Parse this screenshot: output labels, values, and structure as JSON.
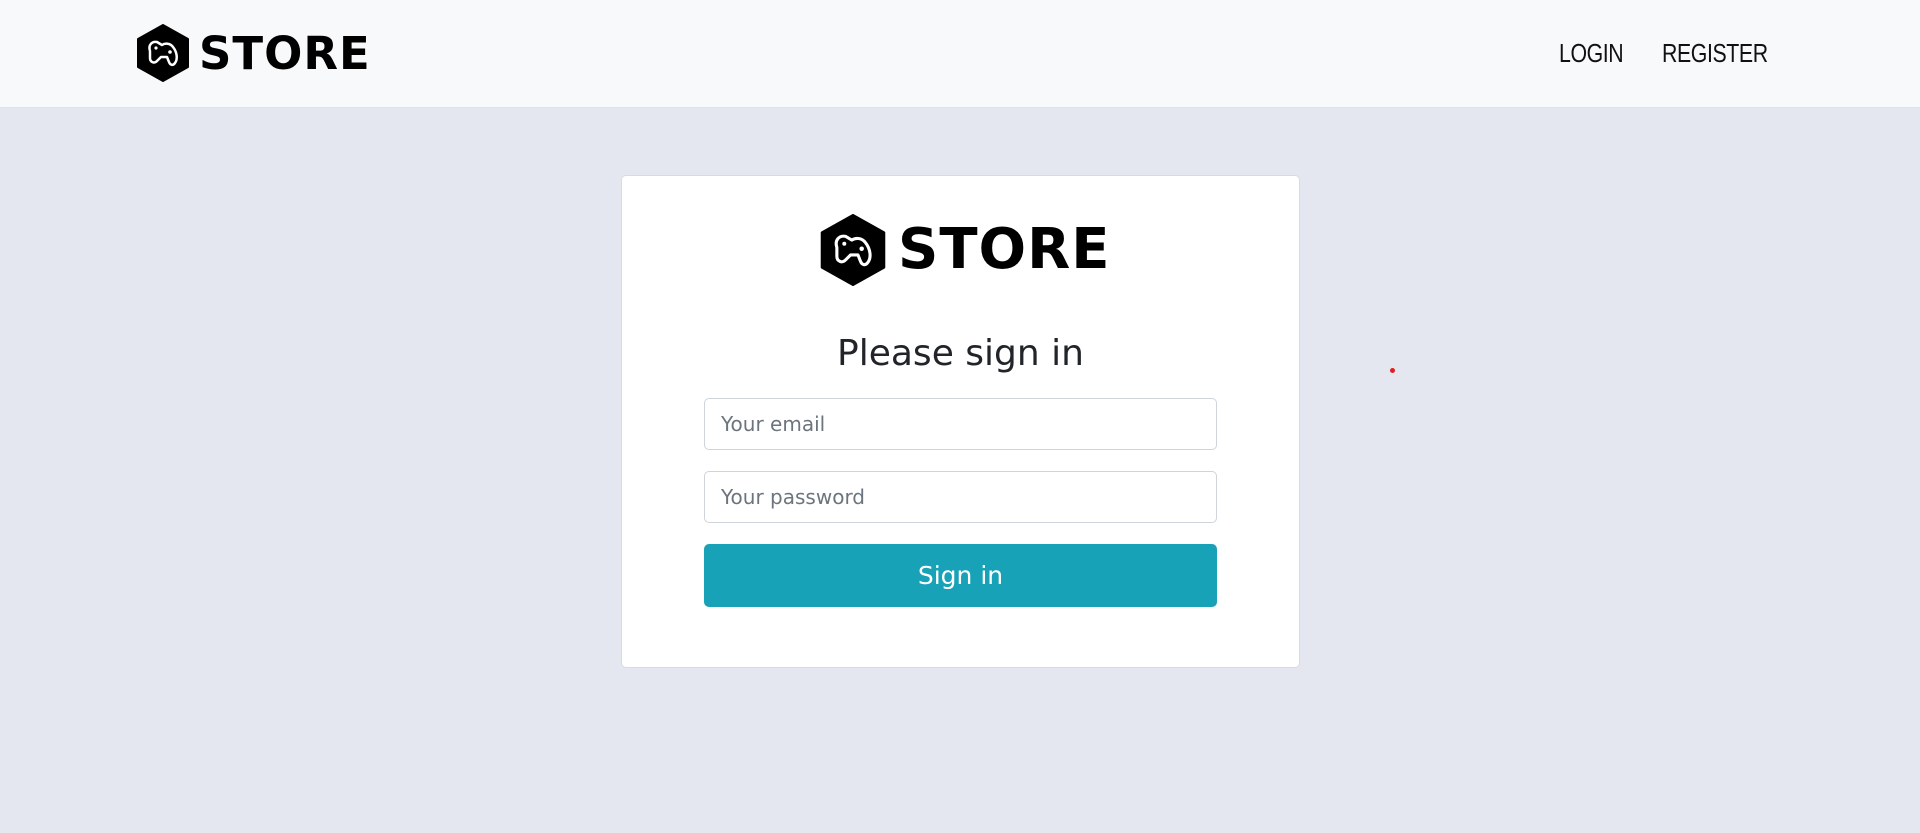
{
  "navbar": {
    "brand": {
      "icon": "gamepad-hexagon-icon",
      "text": "STORE"
    },
    "links": [
      {
        "label": "LOGIN"
      },
      {
        "label": "REGISTER"
      }
    ]
  },
  "signin_card": {
    "logo": {
      "icon": "gamepad-hexagon-icon",
      "text": "STORE"
    },
    "heading": "Please sign in",
    "email": {
      "placeholder": "Your email",
      "value": ""
    },
    "password": {
      "placeholder": "Your password",
      "value": ""
    },
    "submit_label": "Sign in"
  },
  "colors": {
    "page_background": "#e4e7f0",
    "navbar_background": "#f8f9fa",
    "primary_button": "#17a2b8",
    "cursor_marker": "#e02020"
  }
}
